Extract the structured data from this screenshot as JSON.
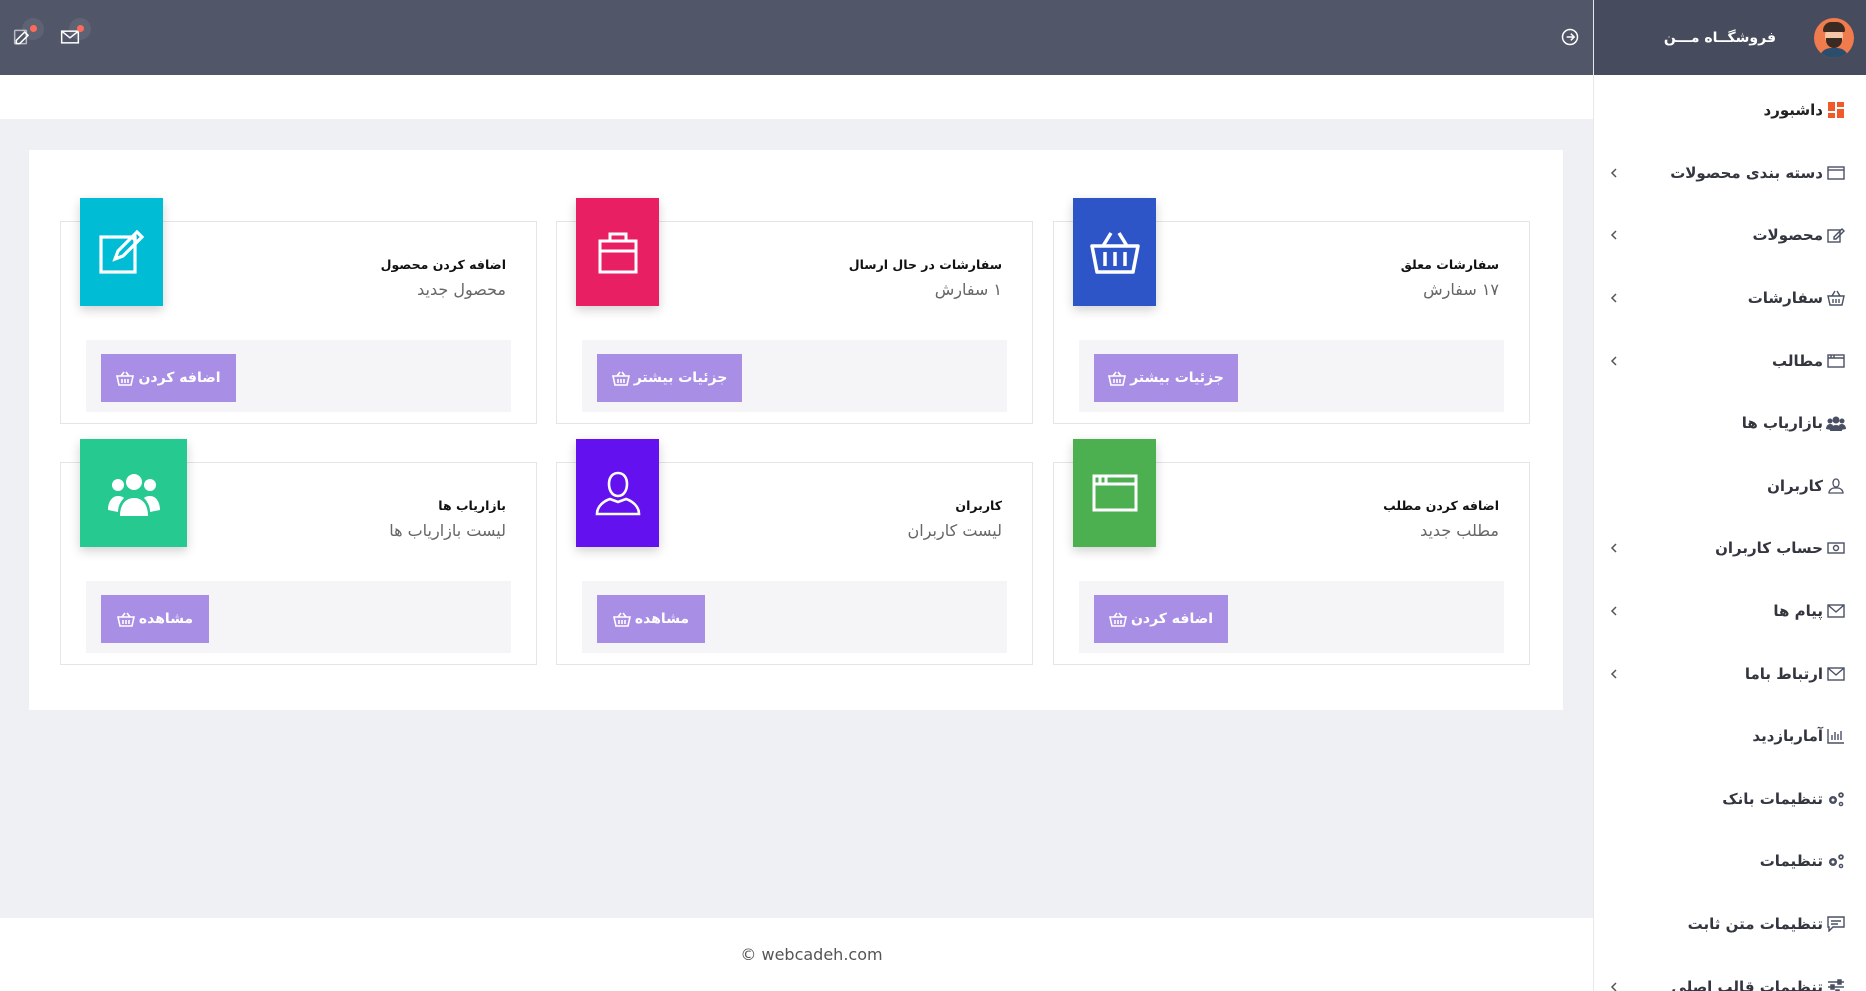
{
  "brand": {
    "name": "فروشگــاه مـــن"
  },
  "colors": {
    "topbar": "#515669",
    "brand_bar": "#474b5e",
    "button": "#a98ee6",
    "tile_blue": "#2d55c7",
    "tile_pink": "#e91f63",
    "tile_cyan": "#00bcd4",
    "tile_green": "#4caf50",
    "tile_violet": "#6311ee",
    "tile_mint": "#26c98f",
    "dashboard_icon": "#f0592a"
  },
  "topbar": {
    "icons": [
      "edit-icon",
      "mail-icon",
      "logout-icon"
    ]
  },
  "sidebar": {
    "items": [
      {
        "label": "داشبورد",
        "icon": "dashboard-icon",
        "chevron": false
      },
      {
        "label": "دسته بندی محصولات",
        "icon": "folder-icon",
        "chevron": true
      },
      {
        "label": "محصولات",
        "icon": "edit-icon",
        "chevron": true
      },
      {
        "label": "سفارشات",
        "icon": "basket-icon",
        "chevron": true
      },
      {
        "label": "مطالب",
        "icon": "window-icon",
        "chevron": true
      },
      {
        "label": "بازاریاب ها",
        "icon": "users-icon",
        "chevron": false
      },
      {
        "label": "کاربران",
        "icon": "user-icon",
        "chevron": false
      },
      {
        "label": "حساب کاربران",
        "icon": "money-icon",
        "chevron": true
      },
      {
        "label": "پیام ها",
        "icon": "mail-icon",
        "chevron": true
      },
      {
        "label": "ارتباط باما",
        "icon": "mail-icon",
        "chevron": true
      },
      {
        "label": "آماربازدید",
        "icon": "chart-icon",
        "chevron": false
      },
      {
        "label": "تنظیمات بانک",
        "icon": "gears-icon",
        "chevron": false
      },
      {
        "label": "تنظیمات",
        "icon": "gears-icon",
        "chevron": false
      },
      {
        "label": "تنظیمات متن ثابت",
        "icon": "comment-icon",
        "chevron": false
      },
      {
        "label": "تنظیمات قالب اصلی",
        "icon": "sliders-icon",
        "chevron": true
      }
    ]
  },
  "cards": [
    {
      "title": "سفارشات معلق",
      "sub": "۱۷ سفارش",
      "button": "جزئیات بیشتر",
      "icon": "basket-icon",
      "tile_color": "#2d55c7"
    },
    {
      "title": "سفارشات در حال ارسال",
      "sub": "۱ سفارش",
      "button": "جزئیات بیشتر",
      "icon": "bag-icon",
      "tile_color": "#e91f63"
    },
    {
      "title": "اضافه کردن محصول",
      "sub": "محصول جدید",
      "button": "اضافه کردن",
      "icon": "edit-icon",
      "tile_color": "#00bcd4"
    },
    {
      "title": "اضافه کردن مطلب",
      "sub": "مطلب جدید",
      "button": "اضافه کردن",
      "icon": "window-icon",
      "tile_color": "#4caf50"
    },
    {
      "title": "کاربران",
      "sub": "لیست کاربران",
      "button": "مشاهده",
      "icon": "user-icon",
      "tile_color": "#6311ee"
    },
    {
      "title": "بازاریاب ها",
      "sub": "لیست بازاریاب ها",
      "button": "مشاهده",
      "icon": "users-icon",
      "tile_color": "#26c98f"
    }
  ],
  "footer": {
    "text": "© webcadeh.com"
  }
}
